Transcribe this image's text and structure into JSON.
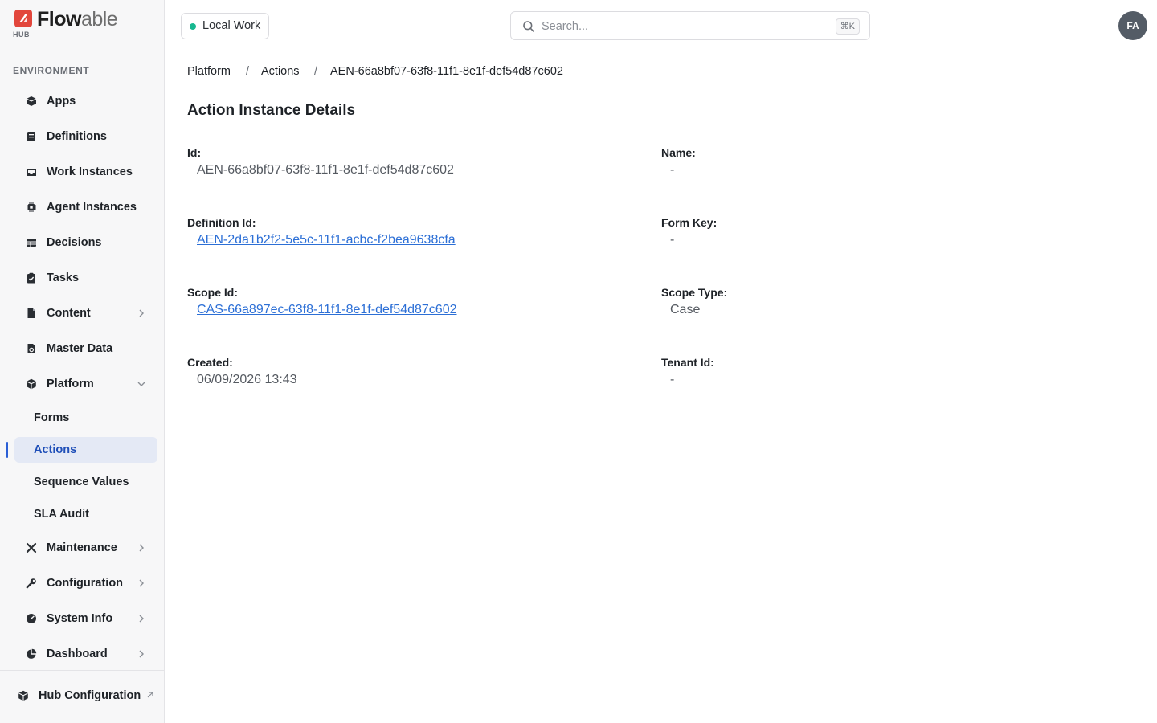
{
  "brand": {
    "logo_text_bold": "Flow",
    "logo_text_light": "able",
    "logo_sub": "HUB"
  },
  "sidebar": {
    "section_label": "ENVIRONMENT",
    "items": [
      {
        "label": "Apps",
        "icon": "box-icon"
      },
      {
        "label": "Definitions",
        "icon": "book-icon"
      },
      {
        "label": "Work Instances",
        "icon": "inbox-icon"
      },
      {
        "label": "Agent Instances",
        "icon": "chip-icon"
      },
      {
        "label": "Decisions",
        "icon": "table-icon"
      },
      {
        "label": "Tasks",
        "icon": "clipboard-check-icon"
      },
      {
        "label": "Content",
        "icon": "document-icon",
        "expandable": true
      },
      {
        "label": "Master Data",
        "icon": "file-cog-icon"
      },
      {
        "label": "Platform",
        "icon": "cube-icon",
        "expanded": true
      }
    ],
    "platform_children": [
      {
        "label": "Forms"
      },
      {
        "label": "Actions",
        "active": true
      },
      {
        "label": "Sequence Values"
      },
      {
        "label": "SLA Audit"
      }
    ],
    "lower_items": [
      {
        "label": "Maintenance",
        "icon": "tools-icon"
      },
      {
        "label": "Configuration",
        "icon": "wrench-icon"
      },
      {
        "label": "System Info",
        "icon": "gauge-icon"
      },
      {
        "label": "Dashboard",
        "icon": "pie-chart-icon"
      }
    ],
    "footer": {
      "label": "Hub Configuration",
      "icon": "cube-icon"
    }
  },
  "topbar": {
    "environment": "Local Work",
    "environment_status_color": "#17b890",
    "search_placeholder": "Search...",
    "search_shortcut": "⌘K",
    "avatar_initials": "FA"
  },
  "breadcrumb": [
    "Platform",
    "Actions",
    "AEN-66a8bf07-63f8-11f1-8e1f-def54d87c602"
  ],
  "page": {
    "title": "Action Instance Details",
    "fields": {
      "id": {
        "label": "Id:",
        "value": "AEN-66a8bf07-63f8-11f1-8e1f-def54d87c602"
      },
      "name": {
        "label": "Name:",
        "value": "-"
      },
      "definition_id": {
        "label": "Definition Id:",
        "value": "AEN-2da1b2f2-5e5c-11f1-acbc-f2bea9638cfa"
      },
      "form_key": {
        "label": "Form Key:",
        "value": "-"
      },
      "scope_id": {
        "label": "Scope Id:",
        "value": "CAS-66a897ec-63f8-11f1-8e1f-def54d87c602"
      },
      "scope_type": {
        "label": "Scope Type:",
        "value": "Case"
      },
      "created": {
        "label": "Created:",
        "value": "06/09/2026 13:43"
      },
      "tenant_id": {
        "label": "Tenant Id:",
        "value": "-"
      }
    }
  },
  "colors": {
    "accent": "#2b5fd6",
    "link": "#2c6fd6",
    "brand_red": "#e2463c"
  }
}
